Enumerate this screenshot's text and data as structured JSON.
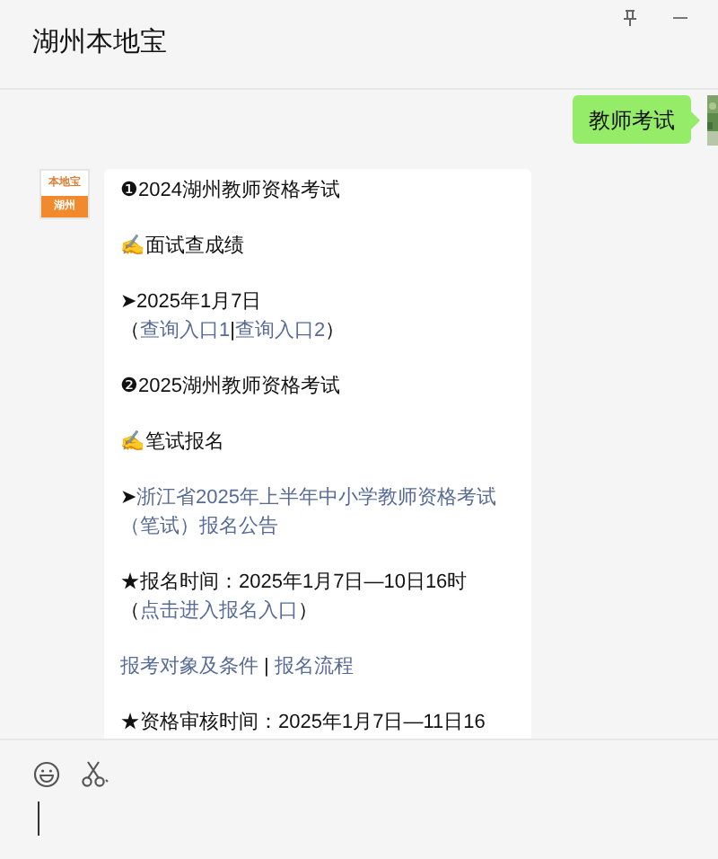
{
  "window": {
    "title": "湖州本地宝"
  },
  "messages": [
    {
      "kind": "outgoing",
      "text": "教师考试"
    },
    {
      "kind": "incoming",
      "avatar": {
        "top": "本地宝",
        "bottom": "湖州"
      },
      "paragraphs": [
        [
          [
            {
              "kind": "text",
              "text": "❶2024湖州教师资格考试"
            }
          ]
        ],
        [
          [
            {
              "kind": "text",
              "text": "✍面试查成绩"
            }
          ]
        ],
        [
          [
            {
              "kind": "text",
              "text": "➤2025年1月7日"
            }
          ],
          [
            {
              "kind": "text",
              "text": "（"
            },
            {
              "kind": "link",
              "text": "查询入口1"
            },
            {
              "kind": "text",
              "text": "|"
            },
            {
              "kind": "link",
              "text": "查询入口2"
            },
            {
              "kind": "text",
              "text": "）"
            }
          ]
        ],
        [
          [
            {
              "kind": "text",
              "text": "❷2025湖州教师资格考试"
            }
          ]
        ],
        [
          [
            {
              "kind": "text",
              "text": "✍笔试报名"
            }
          ]
        ],
        [
          [
            {
              "kind": "text",
              "text": "➤"
            },
            {
              "kind": "link",
              "text": "浙江省2025年上半年中小学教师资格考试"
            }
          ],
          [
            {
              "kind": "link",
              "text": "（笔试）报名公告"
            }
          ]
        ],
        [
          [
            {
              "kind": "text",
              "text": "★报名时间：2025年1月7日—10日16时"
            }
          ],
          [
            {
              "kind": "text",
              "text": "（"
            },
            {
              "kind": "link",
              "text": "点击进入报名入口"
            },
            {
              "kind": "text",
              "text": "）"
            }
          ]
        ],
        [
          [
            {
              "kind": "link",
              "text": "报考对象及条件"
            },
            {
              "kind": "text",
              "text": " | "
            },
            {
              "kind": "link",
              "text": "报名流程"
            }
          ]
        ],
        [
          [
            {
              "kind": "text",
              "text": "★资格审核时间：2025年1月7日—11日16"
            }
          ]
        ]
      ]
    }
  ]
}
